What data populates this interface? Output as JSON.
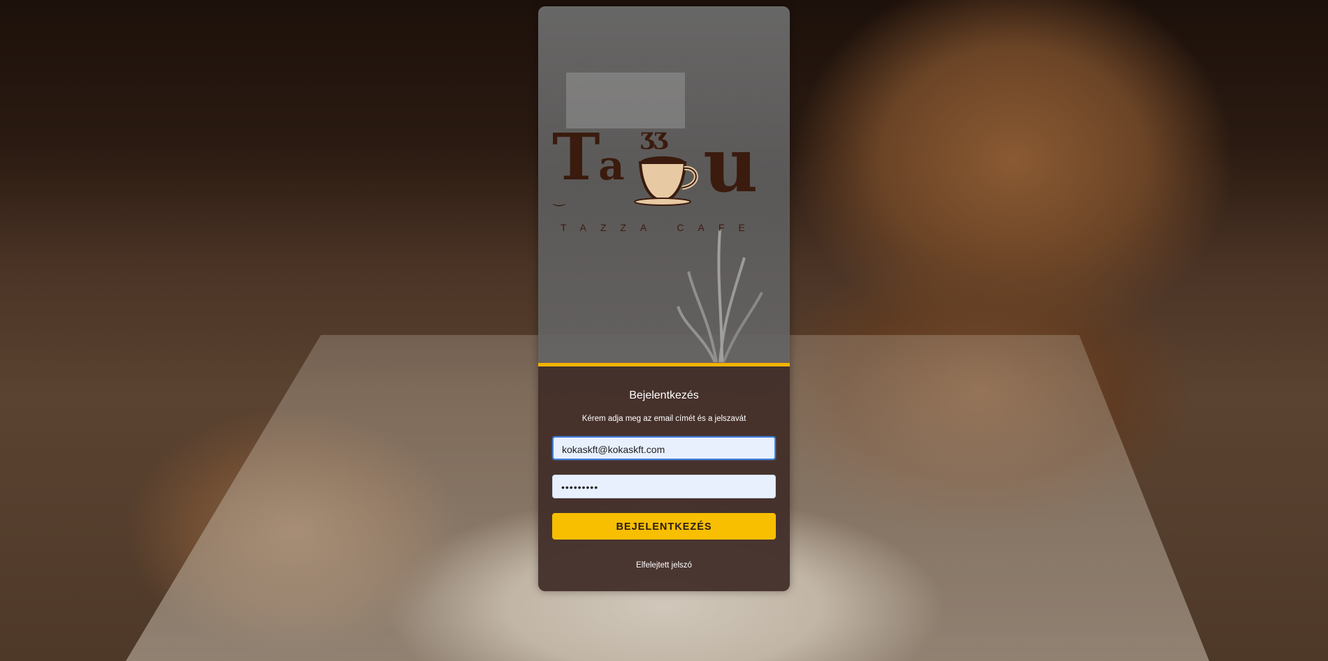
{
  "brand": {
    "logo_text": "Tazza",
    "tagline": "TAZZA CAFE",
    "colors": {
      "logo": "#3a1b0e",
      "accent": "#f4b400"
    }
  },
  "login": {
    "title": "Bejelentkezés",
    "subtitle": "Kérem adja meg az email címét és a jelszavát",
    "email_value": "kokaskft@kokaskft.com",
    "password_value": "•••••••••",
    "submit_label": "BEJELENTKEZÉS",
    "forgot_label": "Elfelejtett jelszó"
  }
}
